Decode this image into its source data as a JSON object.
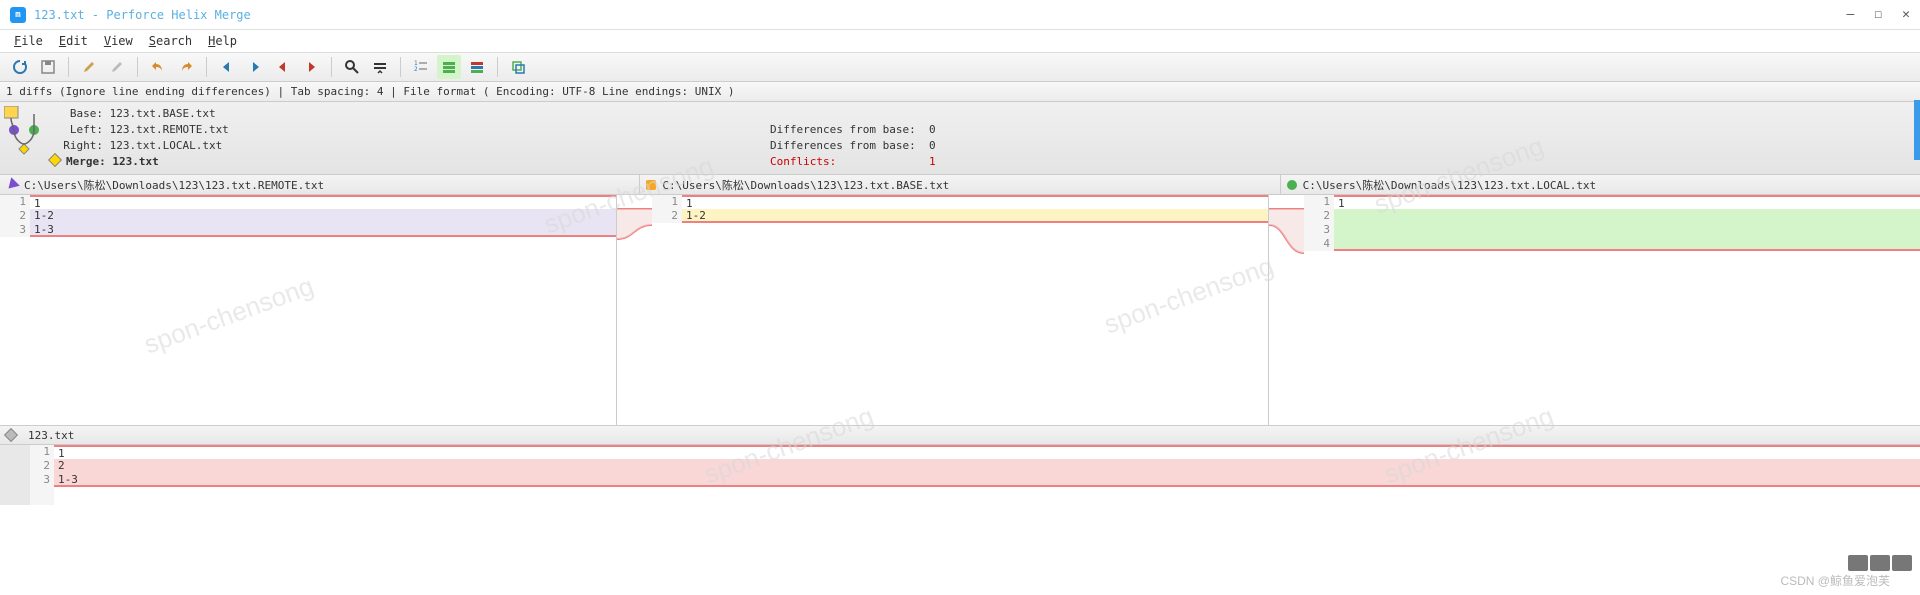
{
  "window": {
    "title": "123.txt - Perforce Helix Merge",
    "app_icon_letter": "m"
  },
  "menu": {
    "file": "File",
    "edit": "Edit",
    "view": "View",
    "search": "Search",
    "help": "Help"
  },
  "status": {
    "line": "1 diffs (Ignore line ending differences) | Tab spacing: 4 | File format ( Encoding: UTF-8  Line endings: UNIX )"
  },
  "info": {
    "base": "   Base: 123.txt.BASE.txt",
    "left": "   Left: 123.txt.REMOTE.txt",
    "right": "  Right: 123.txt.LOCAL.txt",
    "merge": "Merge: 123.txt",
    "diff_left": "Differences from base:  0",
    "diff_right": "Differences from base:  0",
    "conflicts_label": "Conflicts:",
    "conflicts_value": "1"
  },
  "pane_titles": {
    "remote": "C:\\Users\\陈松\\Downloads\\123\\123.txt.REMOTE.txt",
    "base": "C:\\Users\\陈松\\Downloads\\123\\123.txt.BASE.txt",
    "local": "C:\\Users\\陈松\\Downloads\\123\\123.txt.LOCAL.txt"
  },
  "remote_lines": {
    "ln1": "1",
    "t1": "1",
    "ln2": "2",
    "t2": "1-2",
    "ln3": "3",
    "t3": "1-3"
  },
  "base_lines": {
    "ln1": "1",
    "t1": "1",
    "ln2": "2",
    "t2": "1-2"
  },
  "local_lines": {
    "ln1": "1",
    "t1": "1",
    "ln2": "2",
    "t2": "",
    "ln3": "3",
    "t3": "",
    "ln4": "4",
    "t4": ""
  },
  "merge": {
    "title": "123.txt",
    "ln1": "1",
    "t1": "1",
    "ln2": "2",
    "t2": "2",
    "ln3": "3",
    "t3": "1-3"
  },
  "watermark": "spon-chensong",
  "csdn": "CSDN @鲸鱼爱泡芙"
}
